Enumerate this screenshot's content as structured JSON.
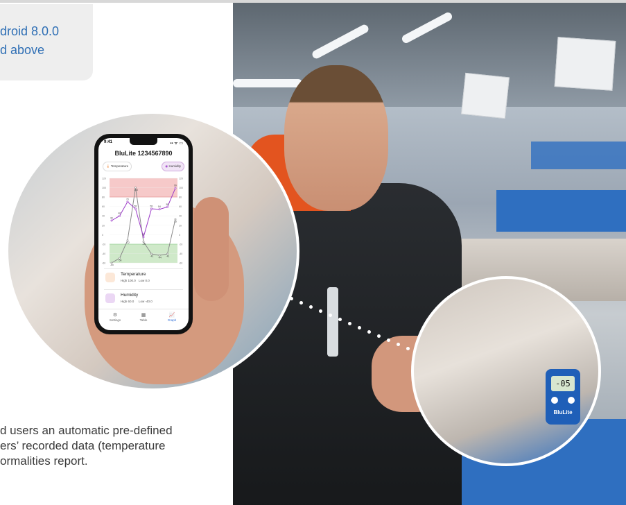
{
  "requirements": {
    "line1": "droid 8.0.0",
    "line2": "d above"
  },
  "description": {
    "line1": "d users an automatic pre-defined",
    "line2": "ers’ recorded data (temperature",
    "line3": "ormalities report."
  },
  "phone_app": {
    "status_time": "9:41",
    "status_indicators": "▪▪ ᯤ ▭",
    "title": "BluLite 1234567890",
    "pills": {
      "temperature": "Temperature",
      "humidity": "Humidity"
    },
    "cards": [
      {
        "name": "Temperature",
        "high": "High 100.0",
        "low": "Low 0.0",
        "color": "#f08a3c"
      },
      {
        "name": "Humidity",
        "high": "High 60.0",
        "low": "Low -40.0",
        "color": "#9b39c8"
      }
    ],
    "tabs": [
      {
        "label": "Settings",
        "icon": "gear-icon"
      },
      {
        "label": "Table",
        "icon": "table-icon"
      },
      {
        "label": "Graph",
        "icon": "graph-icon"
      }
    ],
    "colors": {
      "accent": "#2f6fd8",
      "humidity": "#9b39c8",
      "temperature": "#8a8a8a"
    }
  },
  "chart_data": {
    "type": "line",
    "ylim": [
      -60,
      120
    ],
    "series": [
      {
        "name": "Temperature",
        "color": "#8a8a8a",
        "values": [
          -60,
          -50,
          -12,
          100,
          -15,
          -41,
          -44,
          -41,
          33
        ]
      },
      {
        "name": "Humidity",
        "color": "#9b39c8",
        "values": [
          30,
          40,
          70,
          55,
          -5,
          55,
          54,
          59,
          99
        ]
      }
    ],
    "left_tick_labels": [
      "120",
      "100",
      "80",
      "60",
      "40",
      "20",
      "0",
      "-20",
      "-40",
      "-60"
    ],
    "right_tick_labels": [
      "120",
      "100",
      "80",
      "60",
      "40",
      "20",
      "0",
      "-20",
      "-40",
      "-60"
    ],
    "bands": {
      "high_color": "#f6c9c9",
      "low_color": "#cfe9c9"
    }
  },
  "logger": {
    "display": "-05",
    "brand": "BluLite"
  }
}
